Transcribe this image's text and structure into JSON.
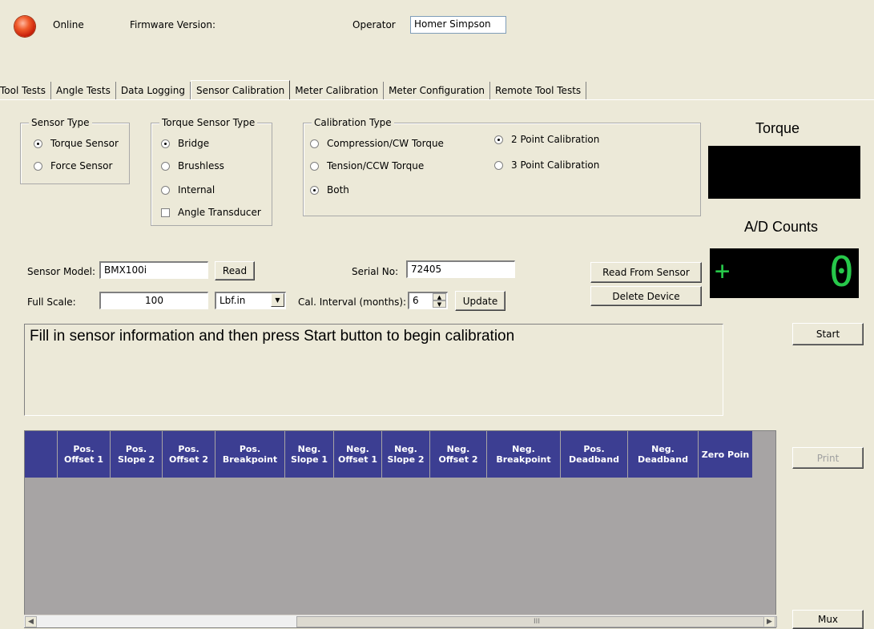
{
  "status": {
    "online_label": "Online",
    "firmware_label": "Firmware Version:",
    "operator_label": "Operator",
    "operator_value": "Homer Simpson"
  },
  "tabs": [
    {
      "label": "Tool Tests"
    },
    {
      "label": "Angle Tests"
    },
    {
      "label": "Data Logging"
    },
    {
      "label": "Sensor Calibration",
      "active": true
    },
    {
      "label": "Meter Calibration"
    },
    {
      "label": "Meter Configuration"
    },
    {
      "label": "Remote Tool Tests"
    }
  ],
  "sensor_type": {
    "title": "Sensor Type",
    "options": [
      "Torque Sensor",
      "Force Sensor"
    ],
    "selected": "Torque Sensor"
  },
  "torque_sensor_type": {
    "title": "Torque Sensor Type",
    "options": [
      "Bridge",
      "Brushless",
      "Internal"
    ],
    "selected": "Bridge",
    "angle_checkbox": "Angle Transducer",
    "angle_checked": false
  },
  "calibration_type": {
    "title": "Calibration Type",
    "direction_options": [
      "Compression/CW Torque",
      "Tension/CCW Torque",
      "Both"
    ],
    "direction_selected": "Both",
    "point_options": [
      "2 Point Calibration",
      "3 Point Calibration"
    ],
    "point_selected": "2 Point Calibration"
  },
  "torque_panel": {
    "label": "Torque",
    "ad_label": "A/D Counts",
    "ad_sign": "+",
    "ad_digit": "0"
  },
  "form": {
    "sensor_model_label": "Sensor Model:",
    "sensor_model_value": "BMX100i",
    "read_button": "Read",
    "serial_label": "Serial No:",
    "serial_value": "72405",
    "full_scale_label": "Full Scale:",
    "full_scale_value": "100",
    "unit_value": "Lbf.in",
    "cal_interval_label": "Cal. Interval (months):",
    "cal_interval_value": "6",
    "update_button": "Update",
    "read_from_sensor_button": "Read From Sensor",
    "delete_device_button": "Delete Device"
  },
  "message": "Fill in sensor information and then press Start button to begin calibration",
  "side_buttons": {
    "start": "Start",
    "print": "Print",
    "mux": "Mux"
  },
  "grid": {
    "columns": [
      "",
      "Pos.\nOffset 1",
      "Pos.\nSlope 2",
      "Pos.\nOffset 2",
      "Pos.\nBreakpoint",
      "Neg.\nSlope 1",
      "Neg.\nOffset 1",
      "Neg.\nSlope 2",
      "Neg.\nOffset 2",
      "Neg.\nBreakpoint",
      "Pos.\nDeadband",
      "Neg.\nDeadband",
      "Zero Poin"
    ]
  }
}
